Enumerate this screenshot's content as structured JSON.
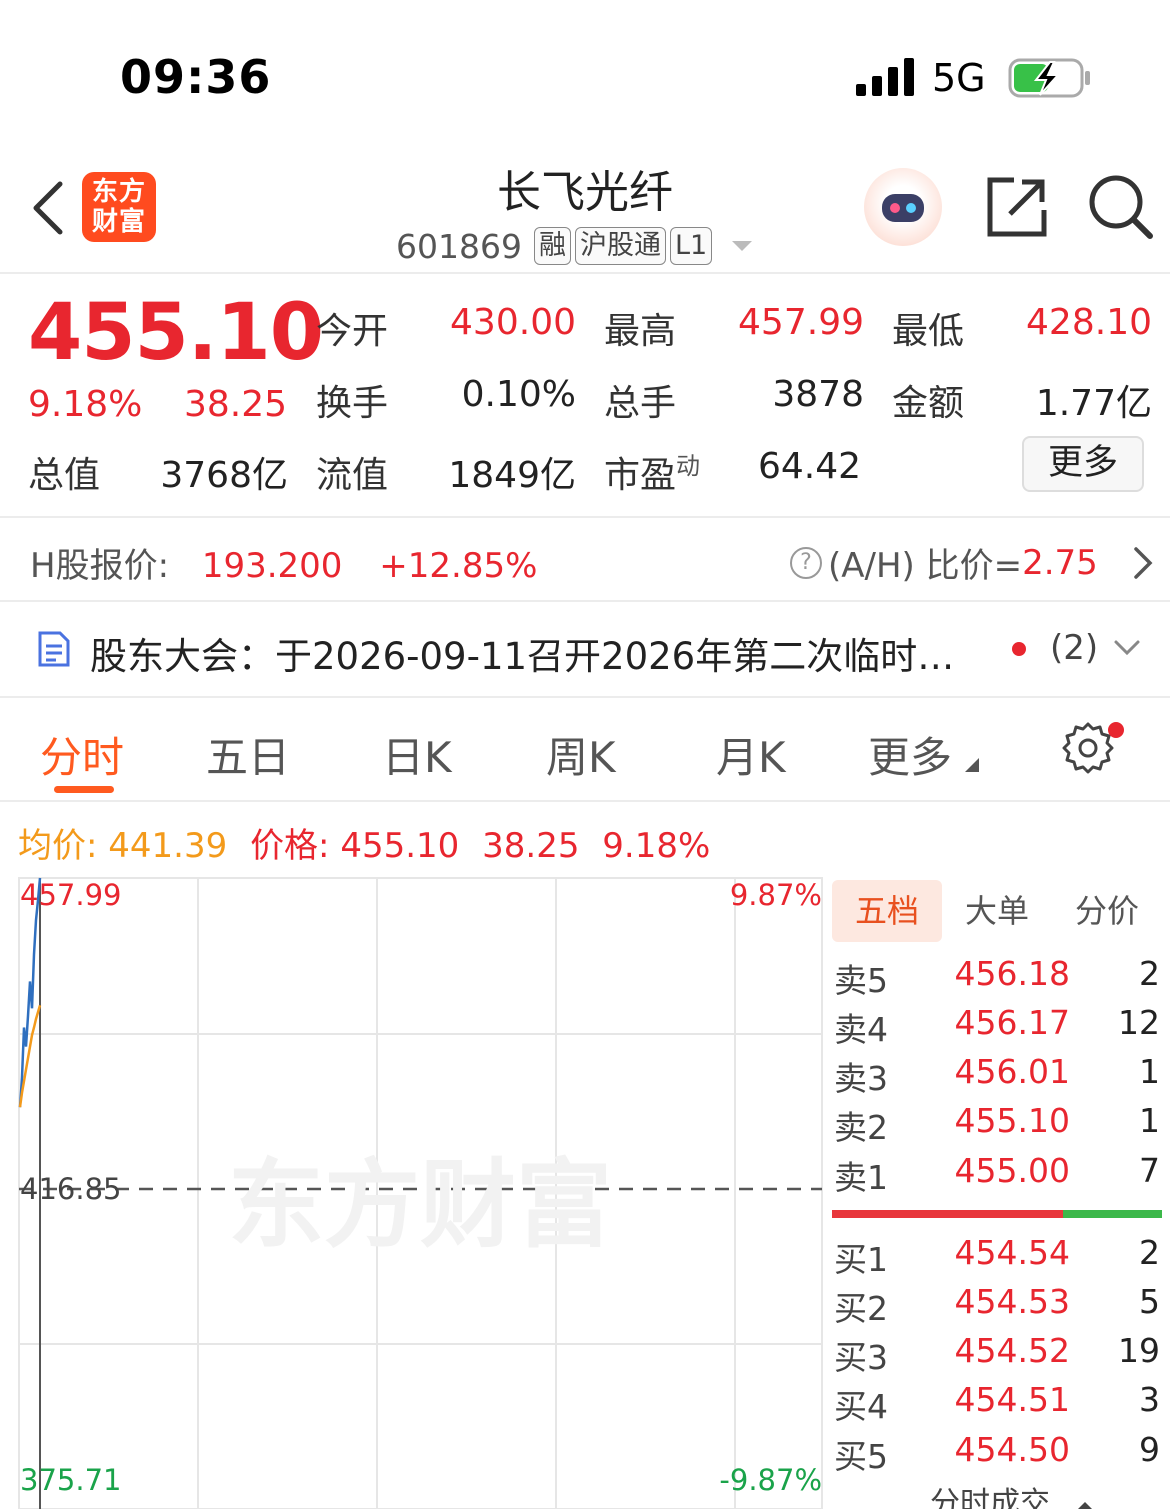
{
  "status_bar": {
    "time": "09:36",
    "network": "5G"
  },
  "header": {
    "logo_text_line1": "东方",
    "logo_text_line2": "财富",
    "stock_name": "长飞光纤",
    "stock_code": "601869",
    "tags": [
      "融",
      "沪股通",
      "L1"
    ]
  },
  "quote": {
    "price": "455.10",
    "change_pct": "9.18%",
    "change_amt": "38.25",
    "open_label": "今开",
    "open": "430.00",
    "high_label": "最高",
    "high": "457.99",
    "low_label": "最低",
    "low": "428.10",
    "turnover_label": "换手",
    "turnover": "0.10%",
    "volume_label": "总手",
    "volume": "3878",
    "amount_label": "金额",
    "amount": "1.77亿",
    "mktcap_label": "总值",
    "mktcap": "3768亿",
    "float_label": "流值",
    "float": "1849亿",
    "pe_label": "市盈",
    "pe_sup": "动",
    "pe": "64.42",
    "more_label": "更多"
  },
  "h_share": {
    "label": "H股报价:",
    "price": "193.200",
    "change": "+12.85%",
    "ah_label": "(A/H) 比价=",
    "ah_value": "2.75"
  },
  "notice": {
    "text": "股东大会：于2026-09-11召开2026年第二次临时…",
    "count": "(2)"
  },
  "tabs": [
    "分时",
    "五日",
    "日K",
    "周K",
    "月K",
    "更多"
  ],
  "info_line": {
    "avg_label": "均价:",
    "avg": "441.39",
    "price_label": "价格:",
    "price": "455.10",
    "change_amt": "38.25",
    "change_pct": "9.18%"
  },
  "chart_data": {
    "type": "line",
    "y_labels_left": {
      "top": "457.99",
      "mid": "416.85",
      "bottom": "375.71"
    },
    "y_labels_right": {
      "top": "9.87%",
      "bottom": "-9.87%"
    },
    "ylim": [
      375.71,
      457.99
    ],
    "prev_close": 416.85,
    "watermark": "东方财富",
    "series": [
      {
        "values": [
          428.1,
          432.0,
          438.5,
          436.0,
          440.0,
          444.5,
          441.0,
          448.0,
          452.5,
          455.1,
          457.99
        ],
        "color": "#2f6fbf"
      },
      {
        "values": [
          428.1,
          430.0,
          431.5,
          433.0,
          434.5,
          436.0,
          437.5,
          438.5,
          439.6,
          440.5,
          441.39
        ],
        "color": "#f39a1b"
      }
    ]
  },
  "order_book": {
    "tabs": [
      "五档",
      "大单",
      "分价"
    ],
    "asks": [
      {
        "label": "卖5",
        "price": "456.18",
        "vol": "2"
      },
      {
        "label": "卖4",
        "price": "456.17",
        "vol": "12"
      },
      {
        "label": "卖3",
        "price": "456.01",
        "vol": "1"
      },
      {
        "label": "卖2",
        "price": "455.10",
        "vol": "1"
      },
      {
        "label": "卖1",
        "price": "455.00",
        "vol": "7"
      }
    ],
    "bids": [
      {
        "label": "买1",
        "price": "454.54",
        "vol": "2"
      },
      {
        "label": "买2",
        "price": "454.53",
        "vol": "5"
      },
      {
        "label": "买3",
        "price": "454.52",
        "vol": "19"
      },
      {
        "label": "买4",
        "price": "454.51",
        "vol": "3"
      },
      {
        "label": "买5",
        "price": "454.50",
        "vol": "9"
      }
    ],
    "buy_ratio": 0.7,
    "footer": "分时成交"
  }
}
